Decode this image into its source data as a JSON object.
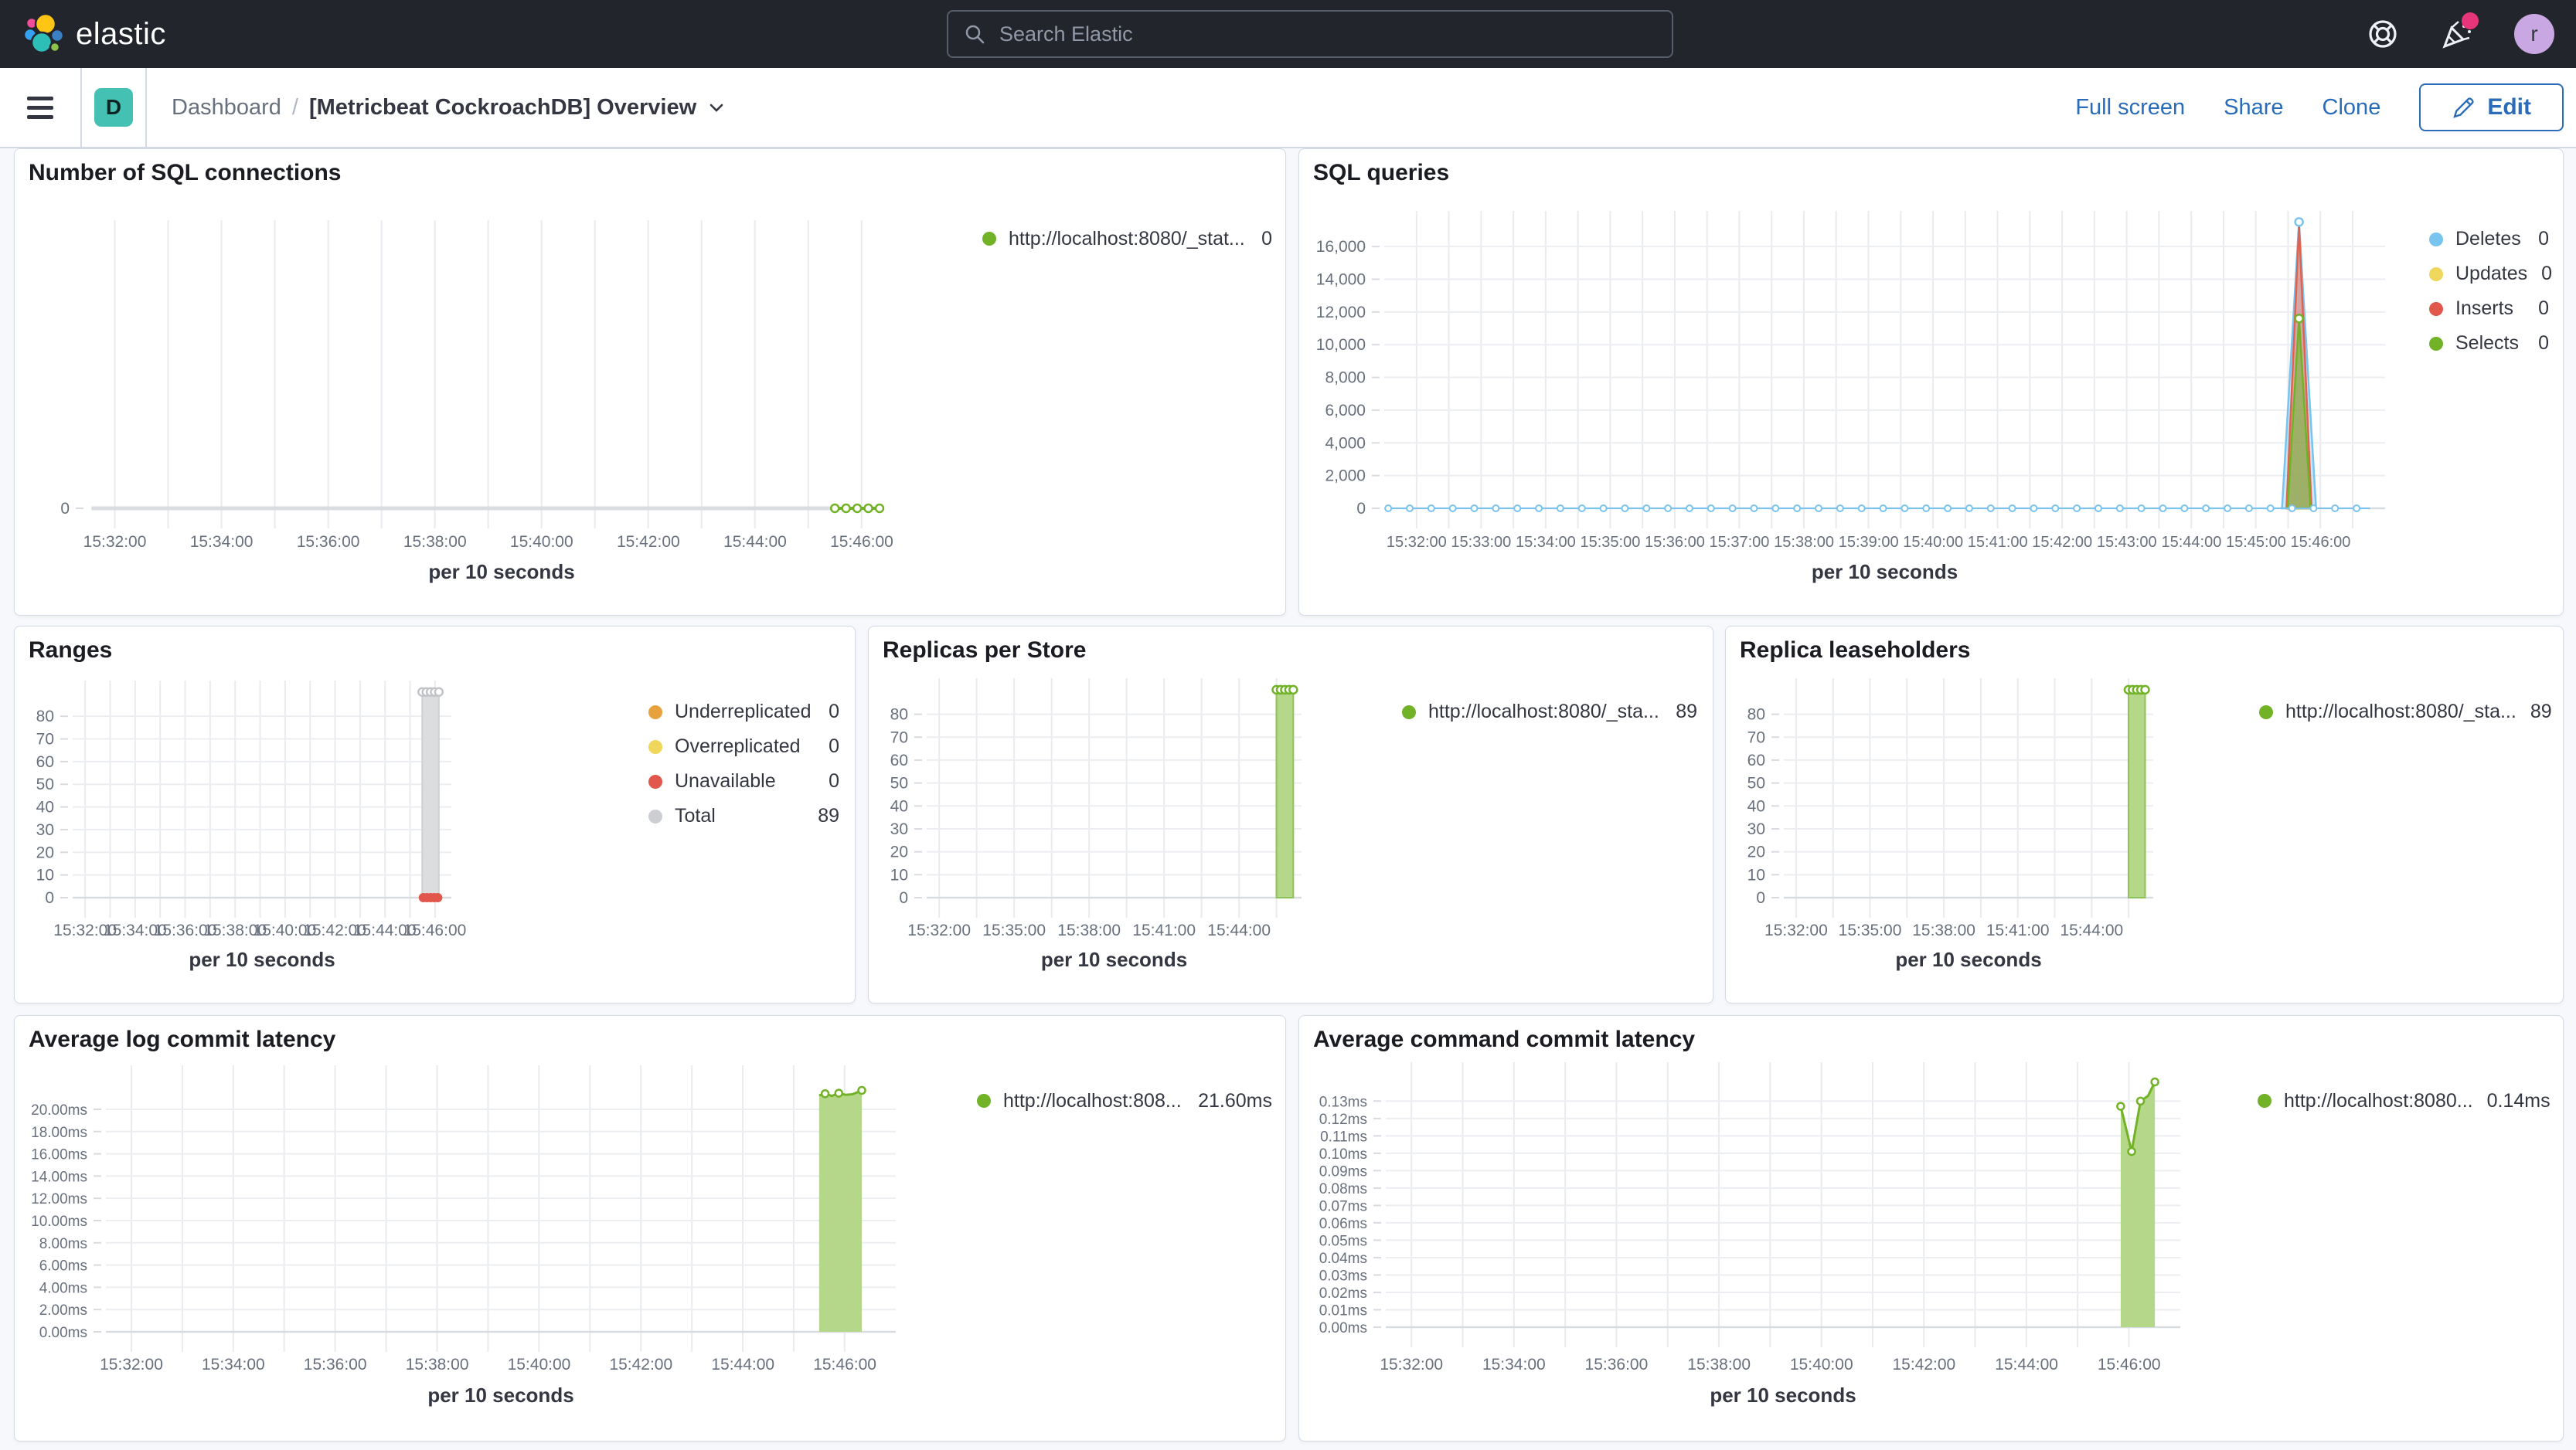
{
  "topbar": {
    "brand": "elastic",
    "search_placeholder": "Search Elastic",
    "avatar_initial": "r"
  },
  "navbar": {
    "app_badge": "D",
    "breadcrumb_root": "Dashboard",
    "breadcrumb_sep": "/",
    "title": "[Metricbeat CockroachDB] Overview",
    "actions": {
      "full_screen": "Full screen",
      "share": "Share",
      "clone": "Clone",
      "edit": "Edit"
    }
  },
  "colors": {
    "accent_blue": "#2a6cb7",
    "header_bg": "#23252d",
    "app_badge_teal": "#45c1b4",
    "avatar_purple": "#c9a7e3",
    "notification_pink": "#e7347b",
    "panel_border": "#d3dae6",
    "series_green": "#72b226",
    "series_blue": "#79c3ef",
    "series_yellow": "#efd75c",
    "series_red": "#e2574c",
    "series_orange": "#e8a23d",
    "series_gray": "#cdced1"
  },
  "chart_data": [
    {
      "type": "line",
      "title": "Number of SQL connections",
      "xlabel": "per 10 seconds",
      "x_ticks": [
        "15:32:00",
        "15:34:00",
        "15:36:00",
        "15:38:00",
        "15:40:00",
        "15:42:00",
        "15:44:00",
        "15:46:00"
      ],
      "x_tick_fractions": [
        0.0323,
        0.1613,
        0.2903,
        0.4194,
        0.5484,
        0.6774,
        0.8065,
        0.9355
      ],
      "y_tick_labels": [
        "0"
      ],
      "y_tick_values": [
        0
      ],
      "y_domain_max": 1,
      "baseline": false,
      "legend": [
        {
          "label": "http://localhost:8080/_stat...",
          "value": "0",
          "color": "#72b226"
        }
      ],
      "series": [
        {
          "kind": "run-line",
          "color": "#d9dce1",
          "width": 5,
          "y": 0,
          "x0": 0.004,
          "x1": 0.903,
          "markers": 0
        },
        {
          "kind": "run-line",
          "color": "#72b226",
          "width": 4,
          "y": 0,
          "x0": 0.903,
          "x1": 0.957,
          "markers": 5
        }
      ]
    },
    {
      "type": "line",
      "title": "SQL queries",
      "xlabel": "per 10 seconds",
      "x_ticks": [
        "15:32:00",
        "15:33:00",
        "15:34:00",
        "15:35:00",
        "15:36:00",
        "15:37:00",
        "15:38:00",
        "15:39:00",
        "15:40:00",
        "15:41:00",
        "15:42:00",
        "15:43:00",
        "15:44:00",
        "15:45:00",
        "15:46:00"
      ],
      "x_tick_fractions": [
        0.0323,
        0.0968,
        0.1613,
        0.2258,
        0.2903,
        0.3548,
        0.4194,
        0.4839,
        0.5484,
        0.6129,
        0.6774,
        0.7419,
        0.8065,
        0.871,
        0.9355
      ],
      "y_tick_labels": [
        "0",
        "2,000",
        "4,000",
        "6,000",
        "8,000",
        "10,000",
        "12,000",
        "14,000",
        "16,000"
      ],
      "y_tick_values": [
        0,
        2000,
        4000,
        6000,
        8000,
        10000,
        12000,
        14000,
        16000
      ],
      "y_domain_max": 17800,
      "legend": [
        {
          "label": "Deletes",
          "value": "0",
          "color": "#79c3ef"
        },
        {
          "label": "Updates",
          "value": "0",
          "color": "#efd75c"
        },
        {
          "label": "Inserts",
          "value": "0",
          "color": "#e2574c"
        },
        {
          "label": "Selects",
          "value": "0",
          "color": "#72b226"
        }
      ],
      "series": [
        {
          "kind": "spike",
          "stroke": "#79c3ef",
          "fill": "rgba(121,195,239,0.38)",
          "apex": 17500,
          "xc": 0.914,
          "xh": 0.017
        },
        {
          "kind": "spike",
          "stroke": "#e0634f",
          "fill": "rgba(224,99,79,0.5)",
          "apex": 17300,
          "xc": 0.914,
          "xh": 0.0125
        },
        {
          "kind": "spike",
          "stroke": "#72b226",
          "fill": "rgba(125,182,66,0.62)",
          "apex": 11600,
          "xc": 0.914,
          "xh": 0.0115
        },
        {
          "kind": "dotted-line",
          "color": "#79c3ef",
          "y": 0,
          "x0": 0.004,
          "x1": 0.985,
          "marker_step": 0.0215
        },
        {
          "kind": "marker",
          "x": 0.914,
          "value": 17500,
          "color": "#79c3ef"
        },
        {
          "kind": "marker",
          "x": 0.914,
          "value": 11600,
          "color": "#72b226"
        }
      ]
    },
    {
      "type": "bar",
      "title": "Ranges",
      "xlabel": "per 10 seconds",
      "x_ticks": [
        "15:32:00",
        "15:34:00",
        "15:36:00",
        "15:38:00",
        "15:40:00",
        "15:42:00",
        "15:44:00",
        "15:46:00"
      ],
      "x_tick_fractions": [
        0.033,
        0.165,
        0.297,
        0.429,
        0.56,
        0.692,
        0.824,
        0.956
      ],
      "y_tick_labels": [
        "0",
        "10",
        "20",
        "30",
        "40",
        "50",
        "60",
        "70",
        "80"
      ],
      "y_tick_values": [
        0,
        10,
        20,
        30,
        40,
        50,
        60,
        70,
        80
      ],
      "y_domain_max": 93,
      "legend": [
        {
          "label": "Underreplicated",
          "value": "0",
          "color": "#e8a23d"
        },
        {
          "label": "Overreplicated",
          "value": "0",
          "color": "#efd75c"
        },
        {
          "label": "Unavailable",
          "value": "0",
          "color": "#e2574c"
        },
        {
          "label": "Total",
          "value": "89",
          "color": "#cdced1"
        }
      ],
      "series": [
        {
          "kind": "bar",
          "fill": "#dcdddf",
          "stroke": "#cfd0d3",
          "value": 89,
          "x0": 0.923,
          "x1": 0.967,
          "top_markers": 5,
          "marker_color": "#c3c4c8"
        },
        {
          "kind": "dot-run",
          "color": "#e2574c",
          "y": 0,
          "x0": 0.926,
          "x1": 0.964,
          "n": 5,
          "r": 6
        }
      ]
    },
    {
      "type": "bar",
      "title": "Replicas per Store",
      "xlabel": "per 10 seconds",
      "x_ticks": [
        "15:32:00",
        "15:35:00",
        "15:38:00",
        "15:41:00",
        "15:44:00"
      ],
      "x_tick_fractions": [
        0.0333,
        0.2333,
        0.4333,
        0.6333,
        0.8333
      ],
      "y_tick_labels": [
        "0",
        "10",
        "20",
        "30",
        "40",
        "50",
        "60",
        "70",
        "80"
      ],
      "y_tick_values": [
        0,
        10,
        20,
        30,
        40,
        50,
        60,
        70,
        80
      ],
      "y_domain_max": 93,
      "legend": [
        {
          "label": "http://localhost:8080/_sta...",
          "value": "89",
          "color": "#72b226"
        }
      ],
      "series": [
        {
          "kind": "bar",
          "fill": "#b5d789",
          "stroke": "#8fc25a",
          "value": 89,
          "x0": 0.933,
          "x1": 0.978,
          "top_markers": 5,
          "marker_color": "#72b226"
        }
      ]
    },
    {
      "type": "bar",
      "title": "Replica leaseholders",
      "xlabel": "per 10 seconds",
      "x_ticks": [
        "15:32:00",
        "15:35:00",
        "15:38:00",
        "15:41:00",
        "15:44:00"
      ],
      "x_tick_fractions": [
        0.0333,
        0.2333,
        0.4333,
        0.6333,
        0.8333
      ],
      "y_tick_labels": [
        "0",
        "10",
        "20",
        "30",
        "40",
        "50",
        "60",
        "70",
        "80"
      ],
      "y_tick_values": [
        0,
        10,
        20,
        30,
        40,
        50,
        60,
        70,
        80
      ],
      "y_domain_max": 93,
      "legend": [
        {
          "label": "http://localhost:8080/_sta...",
          "value": "89",
          "color": "#72b226"
        }
      ],
      "series": [
        {
          "kind": "bar",
          "fill": "#b5d789",
          "stroke": "#8fc25a",
          "value": 89,
          "x0": 0.933,
          "x1": 0.978,
          "top_markers": 5,
          "marker_color": "#72b226"
        }
      ]
    },
    {
      "type": "area",
      "title": "Average log commit latency",
      "xlabel": "per 10 seconds",
      "x_ticks": [
        "15:32:00",
        "15:34:00",
        "15:36:00",
        "15:38:00",
        "15:40:00",
        "15:42:00",
        "15:44:00",
        "15:46:00"
      ],
      "x_tick_fractions": [
        0.0323,
        0.1613,
        0.2903,
        0.4194,
        0.5484,
        0.6774,
        0.8065,
        0.9355
      ],
      "y_tick_labels": [
        "0.00ms",
        "2.00ms",
        "4.00ms",
        "6.00ms",
        "8.00ms",
        "10.00ms",
        "12.00ms",
        "14.00ms",
        "16.00ms",
        "18.00ms",
        "20.00ms"
      ],
      "y_tick_values": [
        0,
        2,
        4,
        6,
        8,
        10,
        12,
        14,
        16,
        18,
        20
      ],
      "y_domain_max": 23.4,
      "legend": [
        {
          "label": "http://localhost:808...",
          "value": "21.60ms",
          "color": "#72b226"
        }
      ],
      "series": [
        {
          "kind": "area",
          "stroke": "#72b226",
          "fill": "#b5d789",
          "x0": 0.903,
          "x1": 0.957,
          "top": [
            [
              0,
              21.25
            ],
            [
              0.14,
              21.4
            ],
            [
              0.3,
              21.2
            ],
            [
              0.46,
              21.45
            ],
            [
              0.62,
              21.3
            ],
            [
              0.78,
              21.35
            ],
            [
              1,
              21.7
            ]
          ],
          "marker_idx": [
            1,
            3,
            6
          ]
        }
      ]
    },
    {
      "type": "area",
      "title": "Average command commit latency",
      "xlabel": "per 10 seconds",
      "x_ticks": [
        "15:32:00",
        "15:34:00",
        "15:36:00",
        "15:38:00",
        "15:40:00",
        "15:42:00",
        "15:44:00",
        "15:46:00"
      ],
      "x_tick_fractions": [
        0.0323,
        0.1613,
        0.2903,
        0.4194,
        0.5484,
        0.6774,
        0.8065,
        0.9355
      ],
      "y_tick_labels": [
        "0.00ms",
        "0.01ms",
        "0.02ms",
        "0.03ms",
        "0.04ms",
        "0.05ms",
        "0.06ms",
        "0.07ms",
        "0.08ms",
        "0.09ms",
        "0.10ms",
        "0.11ms",
        "0.12ms",
        "0.13ms"
      ],
      "y_tick_values": [
        0,
        0.01,
        0.02,
        0.03,
        0.04,
        0.05,
        0.06,
        0.07,
        0.08,
        0.09,
        0.1,
        0.11,
        0.12,
        0.13
      ],
      "y_domain_max": 0.1488,
      "legend": [
        {
          "label": "http://localhost:8080...",
          "value": "0.14ms",
          "color": "#72b226"
        }
      ],
      "series": [
        {
          "kind": "area",
          "stroke": "#72b226",
          "fill": "#b5d789",
          "x0": 0.925,
          "x1": 0.968,
          "top": [
            [
              0,
              0.127
            ],
            [
              0.32,
              0.101
            ],
            [
              0.58,
              0.13
            ],
            [
              0.8,
              0.133
            ],
            [
              1,
              0.141
            ]
          ],
          "marker_idx": [
            0,
            1,
            2,
            4
          ]
        }
      ]
    }
  ]
}
